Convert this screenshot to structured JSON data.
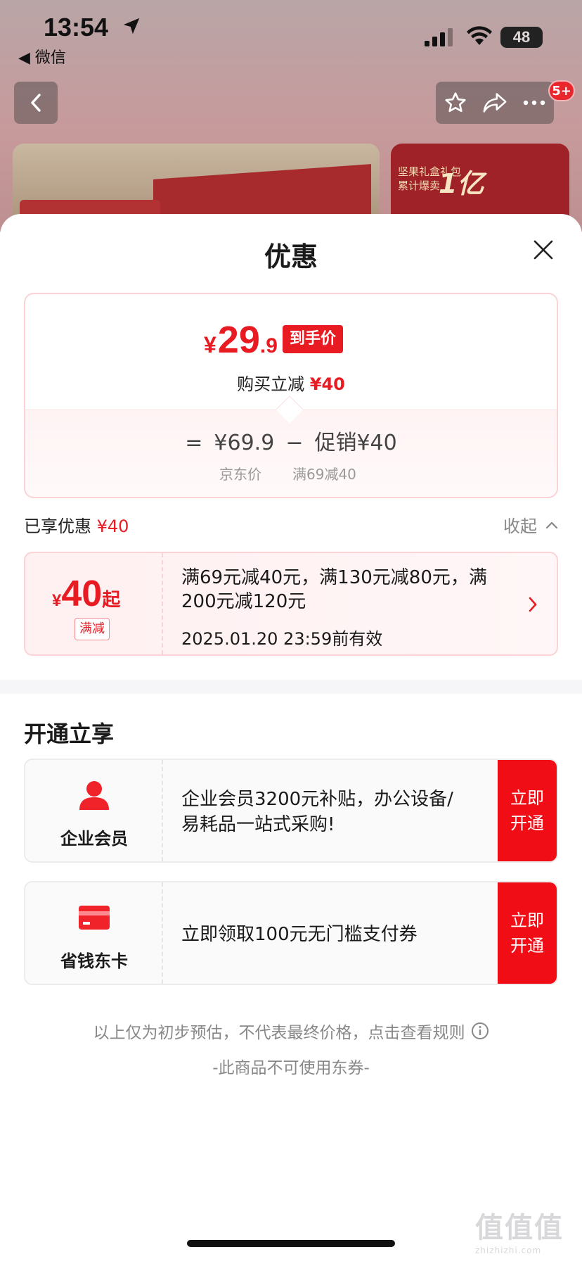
{
  "status_bar": {
    "time": "13:54",
    "back_app": "◀ 微信",
    "battery": "48"
  },
  "product_nav": {
    "badge": "5+"
  },
  "background_banner": {
    "right_line1": "坚果礼盒礼包",
    "right_line2": "累计爆卖",
    "right_big": "1亿",
    "right_sub": "[  ]"
  },
  "sheet": {
    "title": "优惠"
  },
  "price_card": {
    "currency": "¥",
    "price_int": "29",
    "price_dec": ".9",
    "price_tag": "到手价",
    "desc_prefix": "购买立减 ",
    "desc_amount": "¥40",
    "calc_equals": "=",
    "calc_original": "¥69.9",
    "calc_minus": "−",
    "calc_promo": "促销¥40",
    "sub_original": "京东价",
    "sub_promo": "满69减40"
  },
  "enjoyed": {
    "label": "已享优惠 ",
    "amount": "¥40",
    "collapse_label": "收起"
  },
  "coupon": {
    "currency": "¥",
    "amount": "40",
    "suffix": "起",
    "type": "满减",
    "text": "满69元减40元，满130元减80元，满200元减120元",
    "valid": "2025.01.20 23:59前有效"
  },
  "open_section": {
    "title": "开通立享",
    "cards": [
      {
        "name": "企业会员",
        "desc": "企业会员3200元补贴，办公设备/易耗品一站式采购!",
        "button": "立即开通"
      },
      {
        "name": "省钱东卡",
        "desc": "立即领取100元无门槛支付券",
        "button": "立即开通"
      }
    ]
  },
  "footer": {
    "disclaimer": "以上仅为初步预估，不代表最终价格，点击查看规则",
    "no_coupon": "-此商品不可使用东券-"
  },
  "watermark": {
    "big": "值值值",
    "small": "zhizhizhi.com"
  },
  "colors": {
    "accent_red": "#e81b23",
    "button_red": "#f00d16",
    "card_border": "#fbd3d6"
  }
}
